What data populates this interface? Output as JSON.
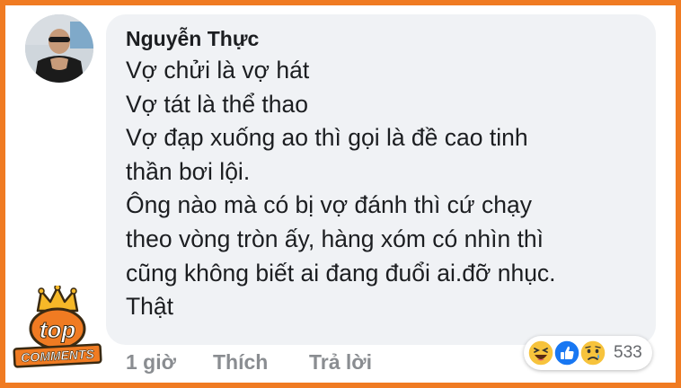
{
  "comment": {
    "author": "Nguyễn Thực",
    "lines": [
      "Vợ chửi là vợ hát",
      "Vợ tát là thể thao",
      "Vợ đạp xuống ao thì gọi là đề cao tinh",
      "thần bơi lội.",
      "Ông nào mà có bị vợ đánh thì cứ chạy",
      "theo vòng tròn ấy, hàng xóm có nhìn thì",
      "cũng không biết ai đang đuổi ai.đỡ nhục.",
      "Thật"
    ]
  },
  "actions": {
    "time": "1 giờ",
    "like": "Thích",
    "reply": "Trả lời"
  },
  "reactions": {
    "icons": [
      "haha-icon",
      "like-icon",
      "sad-icon"
    ],
    "count": "533"
  },
  "watermark": {
    "line1": "top",
    "line2": "COMMENTS"
  },
  "colors": {
    "border": "#f07b22",
    "bubble": "#f0f2f5",
    "like_blue": "#1877f2",
    "emoji_yellow": "#f7c33c"
  }
}
